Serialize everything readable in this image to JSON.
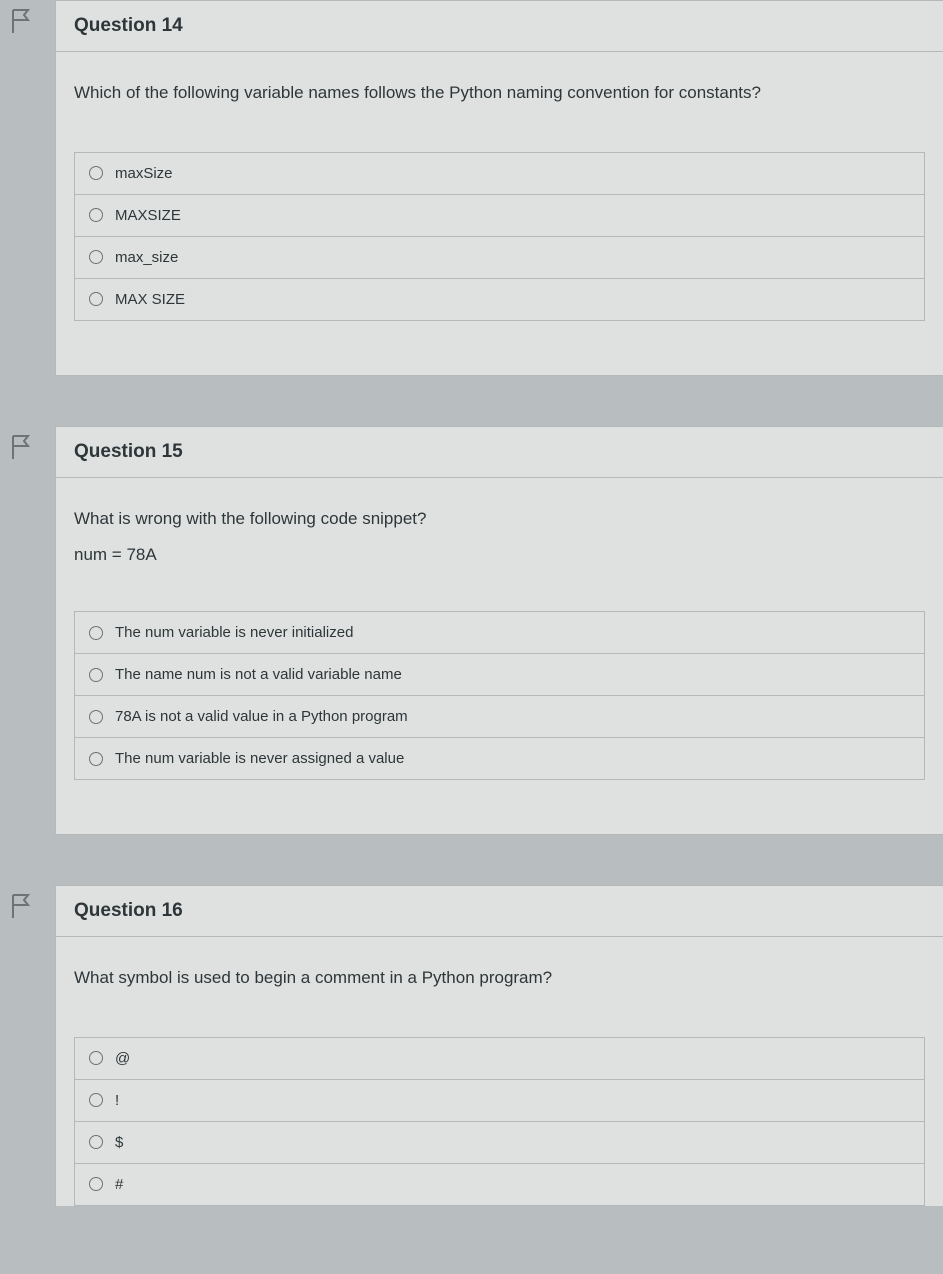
{
  "questions": [
    {
      "title": "Question 14",
      "prompt": "Which of the following variable names follows the Python naming convention for constants?",
      "code": "",
      "options": [
        "maxSize",
        "MAXSIZE",
        "max_size",
        "MAX SIZE"
      ]
    },
    {
      "title": "Question 15",
      "prompt": "What is wrong with the following code snippet?",
      "code": "num = 78A",
      "options": [
        "The num variable is never initialized",
        "The name num is not a valid variable name",
        "78A is not a valid value in a Python program",
        "The num variable is never assigned a value"
      ]
    },
    {
      "title": "Question 16",
      "prompt": "What symbol is used to begin a comment in a Python program?",
      "code": "",
      "options": [
        "@",
        "!",
        "$",
        "#"
      ]
    }
  ]
}
